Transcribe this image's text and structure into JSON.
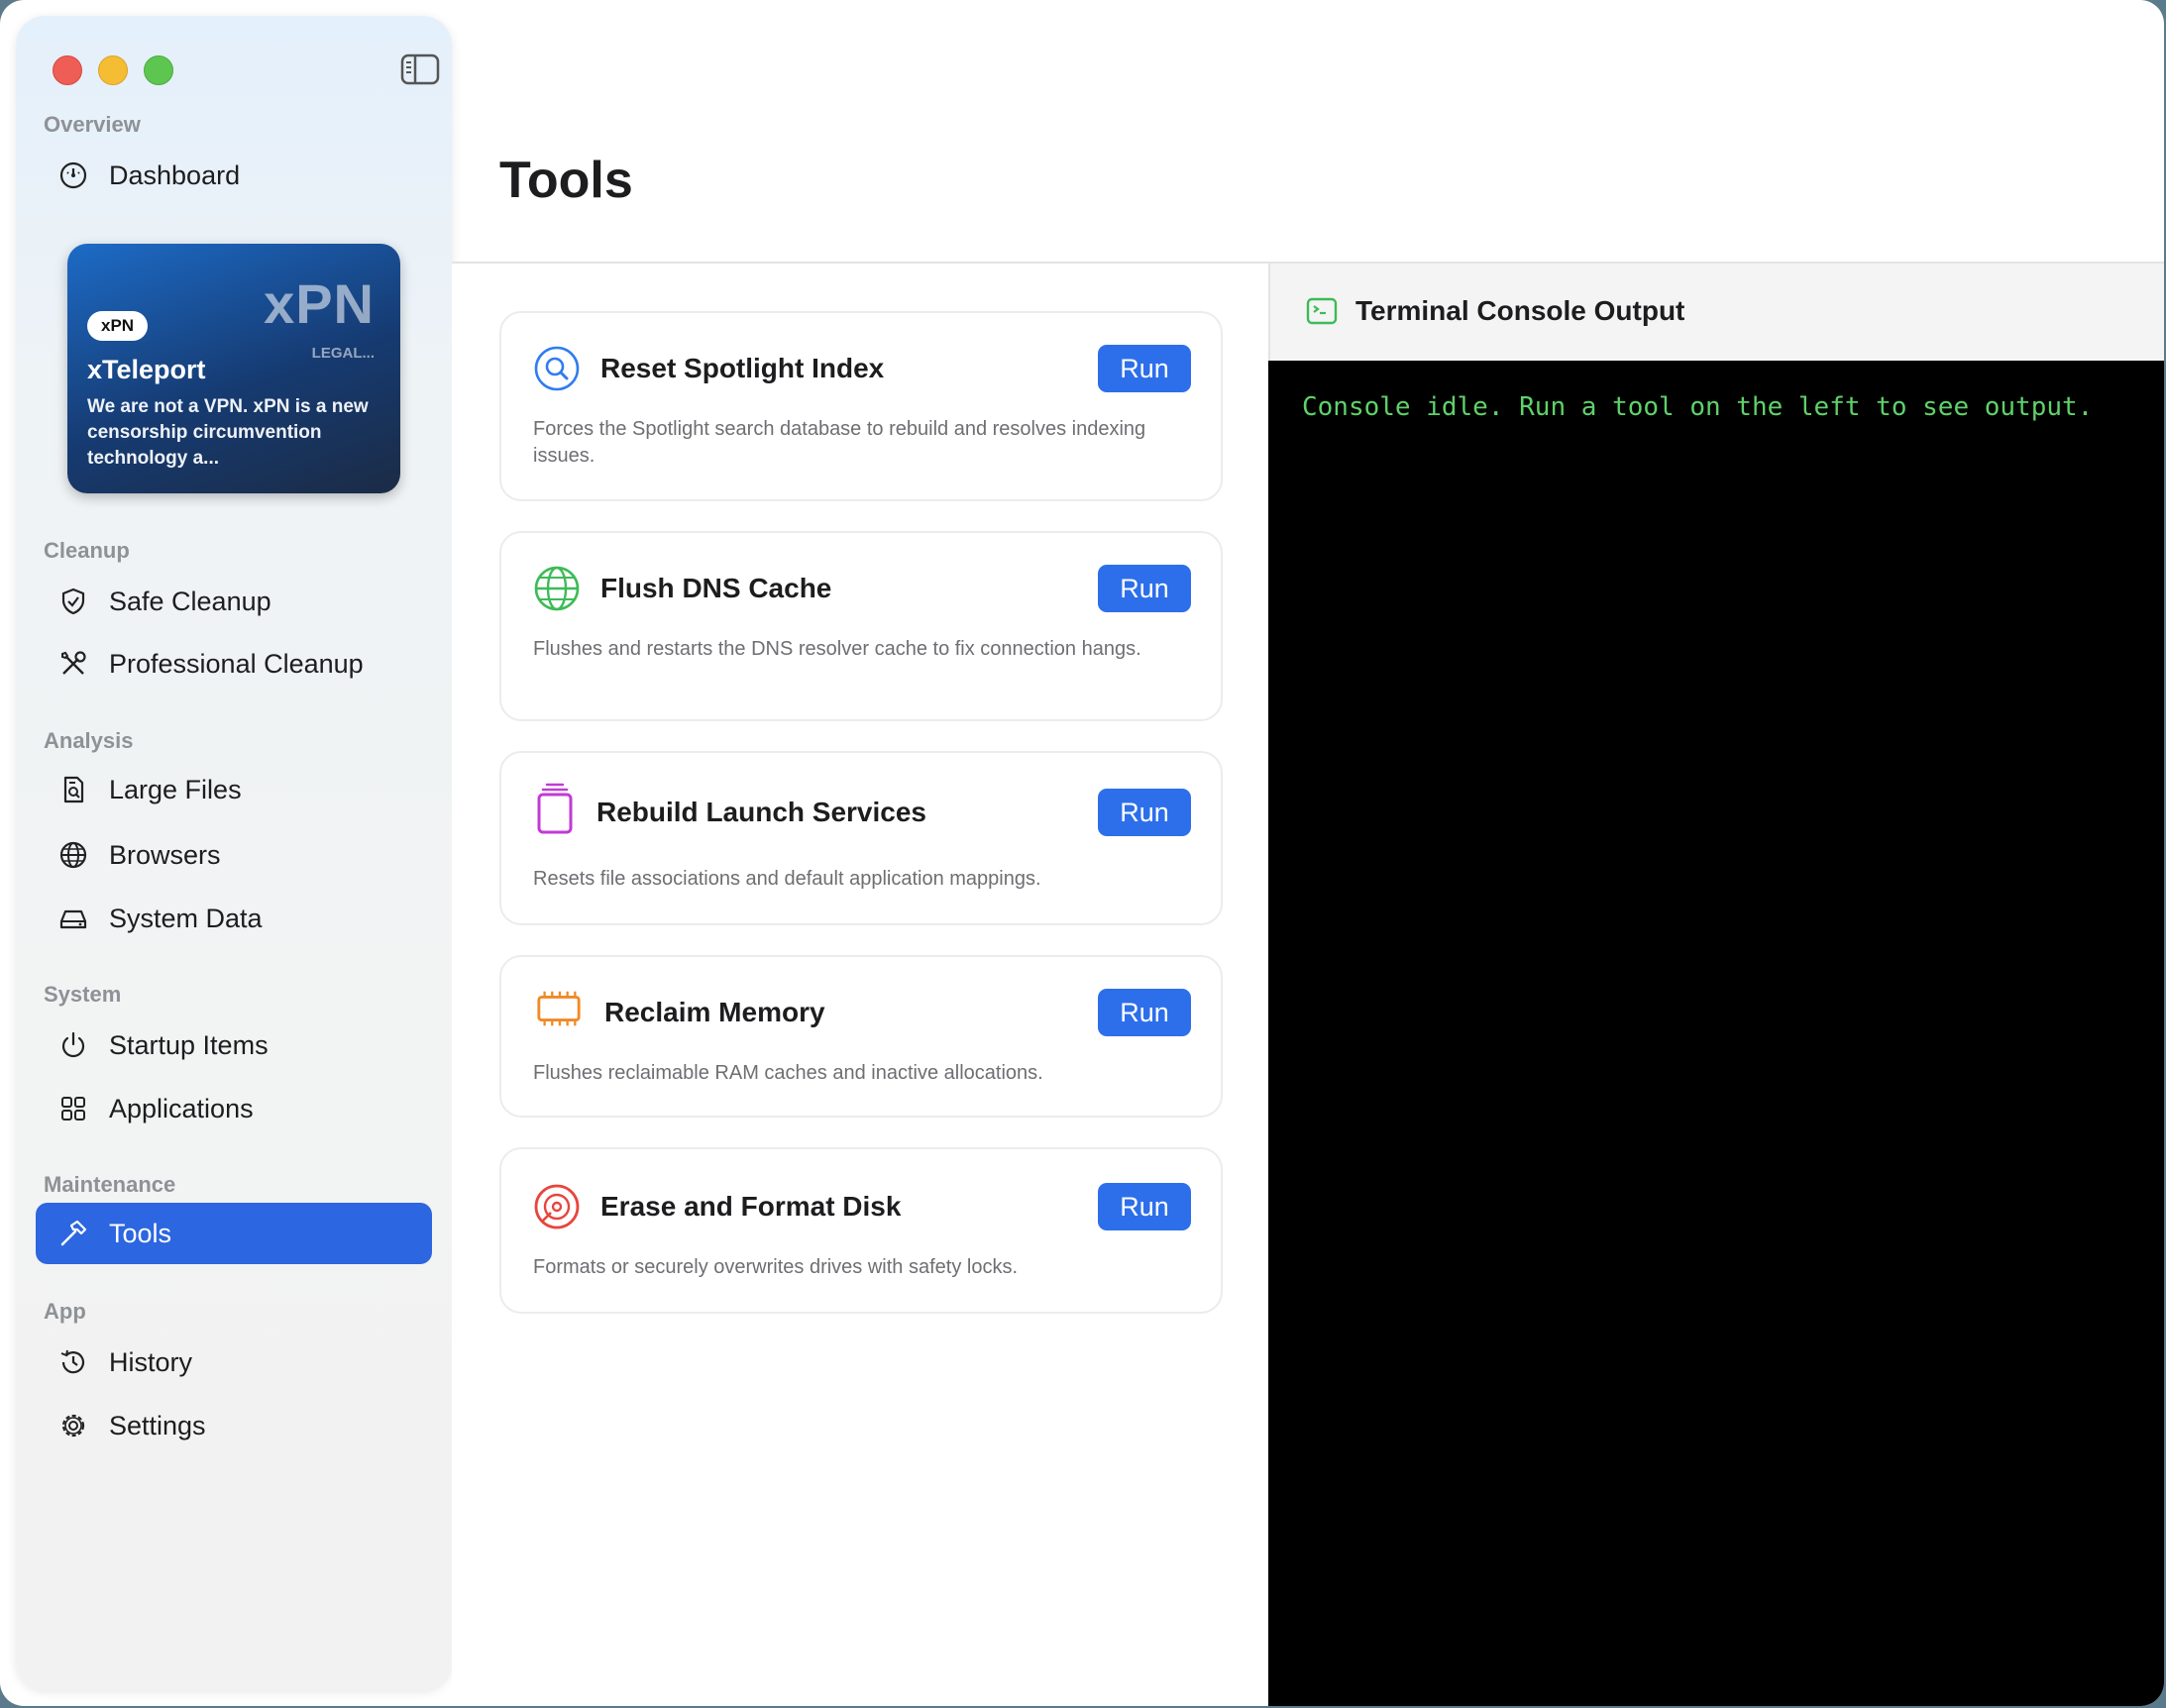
{
  "sidebar": {
    "sections": {
      "overview": "Overview",
      "cleanup": "Cleanup",
      "analysis": "Analysis",
      "system": "System",
      "maintenance": "Maintenance",
      "app": "App"
    },
    "items": {
      "dashboard": "Dashboard",
      "safe_cleanup": "Safe Cleanup",
      "professional_cleanup": "Professional Cleanup",
      "large_files": "Large Files",
      "browsers": "Browsers",
      "system_data": "System Data",
      "startup_items": "Startup Items",
      "applications": "Applications",
      "tools": "Tools",
      "history": "History",
      "settings": "Settings"
    },
    "active_item": "tools",
    "promo": {
      "logo": "xPN",
      "legal": "LEGAL...",
      "badge": "xPN",
      "title": "xTeleport",
      "description": "We are not a VPN. xPN is a new censorship circumvention technology a..."
    }
  },
  "main": {
    "title": "Tools",
    "run_label": "Run",
    "tools": [
      {
        "title": "Reset Spotlight Index",
        "description": "Forces the Spotlight search database to rebuild and resolves indexing issues.",
        "icon": "magnifier-icon",
        "color": "#2f7cf0"
      },
      {
        "title": "Flush DNS Cache",
        "description": "Flushes and restarts the DNS resolver cache to fix connection hangs.",
        "icon": "globe-network-icon",
        "color": "#3dbb57"
      },
      {
        "title": "Rebuild Launch Services",
        "description": "Resets file associations and default application mappings.",
        "icon": "stack-icon",
        "color": "#c23ad6"
      },
      {
        "title": "Reclaim Memory",
        "description": "Flushes reclaimable RAM caches and inactive allocations.",
        "icon": "memory-chip-icon",
        "color": "#f08a24"
      },
      {
        "title": "Erase and Format Disk",
        "description": "Formats or securely overwrites drives with safety locks.",
        "icon": "disk-icon",
        "color": "#e8453c"
      }
    ]
  },
  "console": {
    "title": "Terminal Console Output",
    "output": "Console idle. Run a tool on the left to see output.",
    "text_color": "#5fd16a",
    "icon": "terminal-icon"
  },
  "colors": {
    "accent": "#2d6fea",
    "sidebar_active": "#2c66e0"
  }
}
